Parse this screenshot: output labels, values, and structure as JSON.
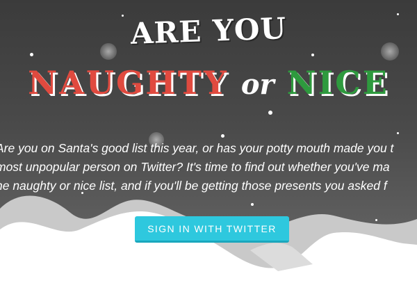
{
  "hero": {
    "title_line1": "ARE YOU",
    "title_naughty": "NAUGHTY",
    "title_or": "or",
    "title_nice": "NICE",
    "intro_lines": [
      "Are you on Santa's good list this year, or has your potty mouth made you t",
      "most unpopular person on Twitter? It's time to find out whether you've ma",
      "he naughty or nice list, and if you'll be getting those presents you asked f"
    ]
  },
  "cta": {
    "signin_label": "SIGN IN WITH TWITTER"
  },
  "colors": {
    "naughty": "#e04a3f",
    "nice": "#2e9a3e",
    "button": "#2ec8de"
  }
}
